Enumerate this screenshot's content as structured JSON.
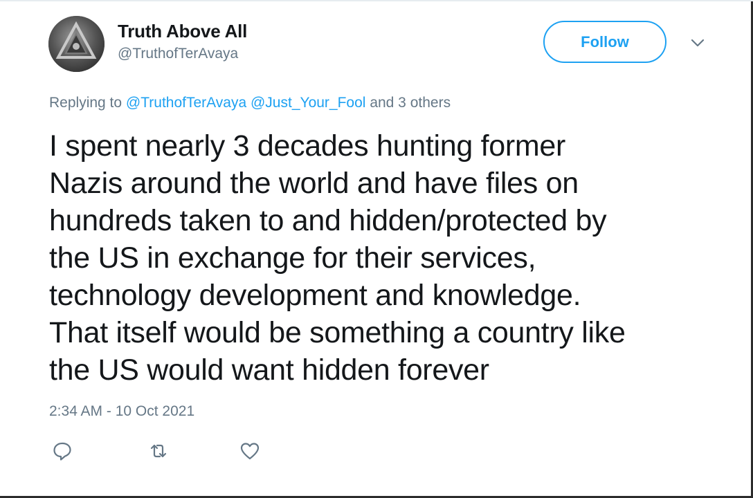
{
  "tweet": {
    "author": {
      "name": "Truth Above All",
      "handle": "@TruthofTerAvaya",
      "avatar_icon": "avatar-triangle-emblem"
    },
    "follow_label": "Follow",
    "replying": {
      "prefix": "Replying to",
      "mentions": [
        "@TruthofTerAvaya",
        "@Just_Your_Fool"
      ],
      "suffix": "and 3 others"
    },
    "text_lines": [
      "I spent nearly 3 decades hunting former",
      "Nazis around the world and have files on",
      "hundreds taken to and hidden/protected by",
      "the US in exchange for their services,",
      "technology development and knowledge.",
      "That itself would be something a country like",
      "the US would want hidden forever"
    ],
    "timestamp": "2:34 AM - 10 Oct 2021",
    "actions": [
      "reply-icon",
      "retweet-icon",
      "like-icon"
    ]
  },
  "colors": {
    "accent": "#1da1f2",
    "text": "#14171a",
    "muted": "#657786"
  }
}
